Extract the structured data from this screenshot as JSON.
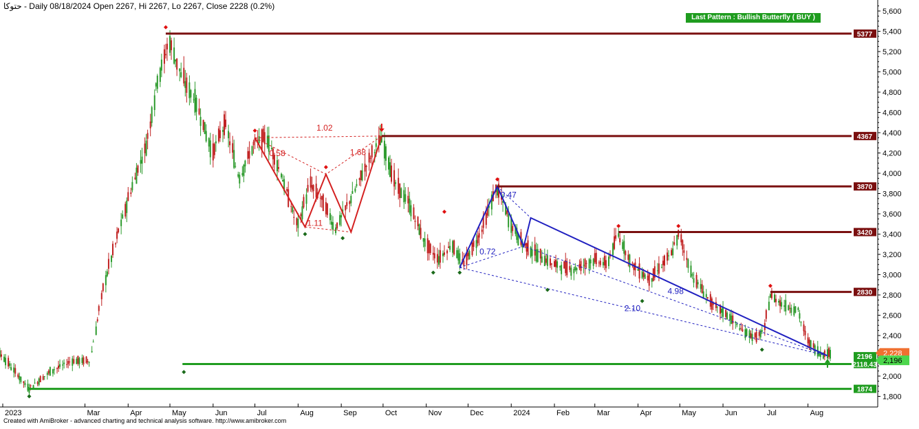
{
  "header": {
    "symbol": "حتوكا",
    "title_text": " - Daily 08/18/2024 Open 2267, Hi 2267, Lo 2267, Close 2228 (0.2%)"
  },
  "pattern_badge": "Last Pattern : Bullish Butterfly ( BUY )",
  "footer": "Created with AmiBroker - advanced charting and technical analysis software. http://www.amibroker.com",
  "colors": {
    "resistance": "#7a0f0f",
    "support": "#1f9c1f",
    "pattern_red": "#d42020",
    "pattern_blue": "#2020c0",
    "candle_up": "#2c9a2c",
    "candle_down": "#c02020",
    "last_price_bg": "#f07030"
  },
  "chart_data": {
    "type": "candlestick",
    "x_axis_labels": [
      "2023",
      "Mar",
      "Apr",
      "May",
      "Jun",
      "Jul",
      "Aug",
      "Sep",
      "Oct",
      "Nov",
      "Dec",
      "2024",
      "Feb",
      "Mar",
      "Apr",
      "May",
      "Jun",
      "Jul",
      "Aug"
    ],
    "x_axis_dates": [
      "2023-01-01",
      "2023-03-01",
      "2023-04-01",
      "2023-05-01",
      "2023-06-01",
      "2023-07-01",
      "2023-08-01",
      "2023-09-01",
      "2023-10-01",
      "2023-11-01",
      "2023-12-01",
      "2024-01-01",
      "2024-02-01",
      "2024-03-01",
      "2024-04-01",
      "2024-05-01",
      "2024-06-01",
      "2024-07-01",
      "2024-08-01"
    ],
    "y_ticks": [
      "1,800",
      "2,000",
      "2,200",
      "2,400",
      "2,600",
      "2,800",
      "3,000",
      "3,200",
      "3,400",
      "3,600",
      "3,800",
      "4,000",
      "4,200",
      "4,400",
      "4,600",
      "4,800",
      "5,000",
      "5,200",
      "5,400",
      "5,600"
    ],
    "y_range": [
      1750,
      5700
    ],
    "grid": false,
    "close_path": [
      [
        "2022-12-15",
        2400
      ],
      [
        "2023-01-01",
        2200
      ],
      [
        "2023-01-20",
        1874
      ],
      [
        "2023-02-05",
        2050
      ],
      [
        "2023-02-20",
        2150
      ],
      [
        "2023-03-05",
        2150
      ],
      [
        "2023-03-15",
        2900
      ],
      [
        "2023-03-25",
        3400
      ],
      [
        "2023-04-05",
        3900
      ],
      [
        "2023-04-15",
        4300
      ],
      [
        "2023-04-22",
        4900
      ],
      [
        "2023-05-01",
        5300
      ],
      [
        "2023-05-10",
        4950
      ],
      [
        "2023-05-20",
        4700
      ],
      [
        "2023-06-01",
        4200
      ],
      [
        "2023-06-10",
        4500
      ],
      [
        "2023-06-20",
        3950
      ],
      [
        "2023-07-01",
        4300
      ],
      [
        "2023-07-10",
        4350
      ],
      [
        "2023-07-20",
        4000
      ],
      [
        "2023-08-01",
        3470
      ],
      [
        "2023-08-10",
        3900
      ],
      [
        "2023-08-20",
        3700
      ],
      [
        "2023-08-28",
        3450
      ],
      [
        "2023-09-10",
        3800
      ],
      [
        "2023-09-20",
        4100
      ],
      [
        "2023-09-30",
        4350
      ],
      [
        "2023-10-10",
        3900
      ],
      [
        "2023-10-20",
        3700
      ],
      [
        "2023-11-01",
        3300
      ],
      [
        "2023-11-10",
        3150
      ],
      [
        "2023-11-20",
        3300
      ],
      [
        "2023-11-28",
        3100
      ],
      [
        "2023-12-10",
        3400
      ],
      [
        "2023-12-22",
        3870
      ],
      [
        "2024-01-01",
        3500
      ],
      [
        "2024-01-10",
        3300
      ],
      [
        "2024-01-20",
        3200
      ],
      [
        "2024-02-01",
        3100
      ],
      [
        "2024-02-15",
        3050
      ],
      [
        "2024-03-01",
        3150
      ],
      [
        "2024-03-10",
        3100
      ],
      [
        "2024-03-18",
        3400
      ],
      [
        "2024-03-28",
        3100
      ],
      [
        "2024-04-10",
        2950
      ],
      [
        "2024-04-25",
        3200
      ],
      [
        "2024-05-01",
        3400
      ],
      [
        "2024-05-10",
        3000
      ],
      [
        "2024-05-25",
        2700
      ],
      [
        "2024-06-05",
        2600
      ],
      [
        "2024-06-15",
        2450
      ],
      [
        "2024-06-25",
        2380
      ],
      [
        "2024-07-01",
        2450
      ],
      [
        "2024-07-05",
        2800
      ],
      [
        "2024-07-15",
        2700
      ],
      [
        "2024-07-25",
        2650
      ],
      [
        "2024-08-01",
        2350
      ],
      [
        "2024-08-10",
        2220
      ],
      [
        "2024-08-18",
        2228
      ]
    ],
    "resistance_levels": [
      {
        "label": "5377",
        "value": 5377,
        "from": "2023-04-28"
      },
      {
        "label": "4367",
        "value": 4367,
        "from": "2023-09-30"
      },
      {
        "label": "3870",
        "value": 3870,
        "from": "2023-12-22"
      },
      {
        "label": "3420",
        "value": 3420,
        "from": "2024-03-18"
      },
      {
        "label": "2830",
        "value": 2830,
        "from": "2024-07-05"
      }
    ],
    "support_levels": [
      {
        "label": "2118.43",
        "value": 2118.43,
        "from": "2023-05-10"
      },
      {
        "label": "1874",
        "value": 1874,
        "from": "2023-01-20"
      }
    ],
    "buy_level": {
      "label": "2196",
      "value": 2196
    },
    "last_price": {
      "label": "2,228",
      "value": 2228
    },
    "support_price": {
      "label": "2,196",
      "value": 2196
    },
    "pattern_lines": [
      {
        "color": "red",
        "style": "solid",
        "points": [
          [
            "2023-07-01",
            4350
          ],
          [
            "2023-08-06",
            3470
          ],
          [
            "2023-08-21",
            3990
          ],
          [
            "2023-09-08",
            3420
          ],
          [
            "2023-09-30",
            4367
          ]
        ]
      },
      {
        "color": "red",
        "style": "dashed",
        "points": [
          [
            "2023-07-01",
            4350
          ],
          [
            "2023-08-21",
            3990
          ],
          [
            "2023-09-30",
            4367
          ]
        ]
      },
      {
        "color": "red",
        "style": "dashed",
        "points": [
          [
            "2023-07-01",
            4350
          ],
          [
            "2023-09-30",
            4367
          ]
        ]
      },
      {
        "color": "red",
        "style": "dashed",
        "points": [
          [
            "2023-08-06",
            3470
          ],
          [
            "2023-09-08",
            3420
          ]
        ]
      },
      {
        "color": "blue",
        "style": "solid",
        "points": [
          [
            "2023-11-25",
            3070
          ],
          [
            "2023-12-22",
            3870
          ],
          [
            "2024-01-10",
            3280
          ],
          [
            "2024-01-15",
            3560
          ],
          [
            "2024-08-15",
            2200
          ]
        ]
      },
      {
        "color": "blue",
        "style": "dashed",
        "points": [
          [
            "2023-11-25",
            3070
          ],
          [
            "2024-01-10",
            3280
          ],
          [
            "2024-08-15",
            2200
          ]
        ]
      },
      {
        "color": "blue",
        "style": "dashed",
        "points": [
          [
            "2023-11-25",
            3070
          ],
          [
            "2024-08-15",
            2200
          ]
        ]
      },
      {
        "color": "blue",
        "style": "dashed",
        "points": [
          [
            "2023-12-22",
            3870
          ],
          [
            "2024-01-15",
            3560
          ]
        ]
      }
    ],
    "ratio_annotations": [
      {
        "text": "1.02",
        "color": "red",
        "x": "2023-08-20",
        "y": 4420
      },
      {
        "text": "0.58",
        "color": "red",
        "x": "2023-07-17",
        "y": 4170
      },
      {
        "text": "1.68",
        "color": "red",
        "x": "2023-09-13",
        "y": 4180
      },
      {
        "text": "1.11",
        "color": "red",
        "x": "2023-08-13",
        "y": 3480
      },
      {
        "text": "0.47",
        "color": "blue",
        "x": "2023-12-30",
        "y": 3760
      },
      {
        "text": "0.72",
        "color": "blue",
        "x": "2023-12-15",
        "y": 3200
      },
      {
        "text": "4.98",
        "color": "blue",
        "x": "2024-04-28",
        "y": 2810
      },
      {
        "text": "2.10",
        "color": "blue",
        "x": "2024-03-28",
        "y": 2640
      }
    ],
    "pivot_highs": [
      [
        "2023-04-28",
        5440
      ],
      [
        "2023-07-01",
        4420
      ],
      [
        "2023-08-21",
        4060
      ],
      [
        "2023-11-14",
        3620
      ],
      [
        "2023-12-22",
        3940
      ],
      [
        "2024-03-18",
        3480
      ],
      [
        "2024-04-30",
        3480
      ],
      [
        "2024-07-05",
        2890
      ]
    ],
    "pivot_lows": [
      [
        "2023-01-20",
        1800
      ],
      [
        "2023-05-11",
        2040
      ],
      [
        "2023-08-06",
        3400
      ],
      [
        "2023-09-02",
        3360
      ],
      [
        "2023-11-06",
        3020
      ],
      [
        "2023-11-25",
        3020
      ],
      [
        "2024-01-27",
        2850
      ],
      [
        "2024-04-04",
        2740
      ],
      [
        "2024-06-29",
        2260
      ]
    ],
    "sell_arrow": [
      "2023-09-30",
      4367
    ],
    "buy_arrow": [
      "2024-08-15",
      2150
    ]
  }
}
